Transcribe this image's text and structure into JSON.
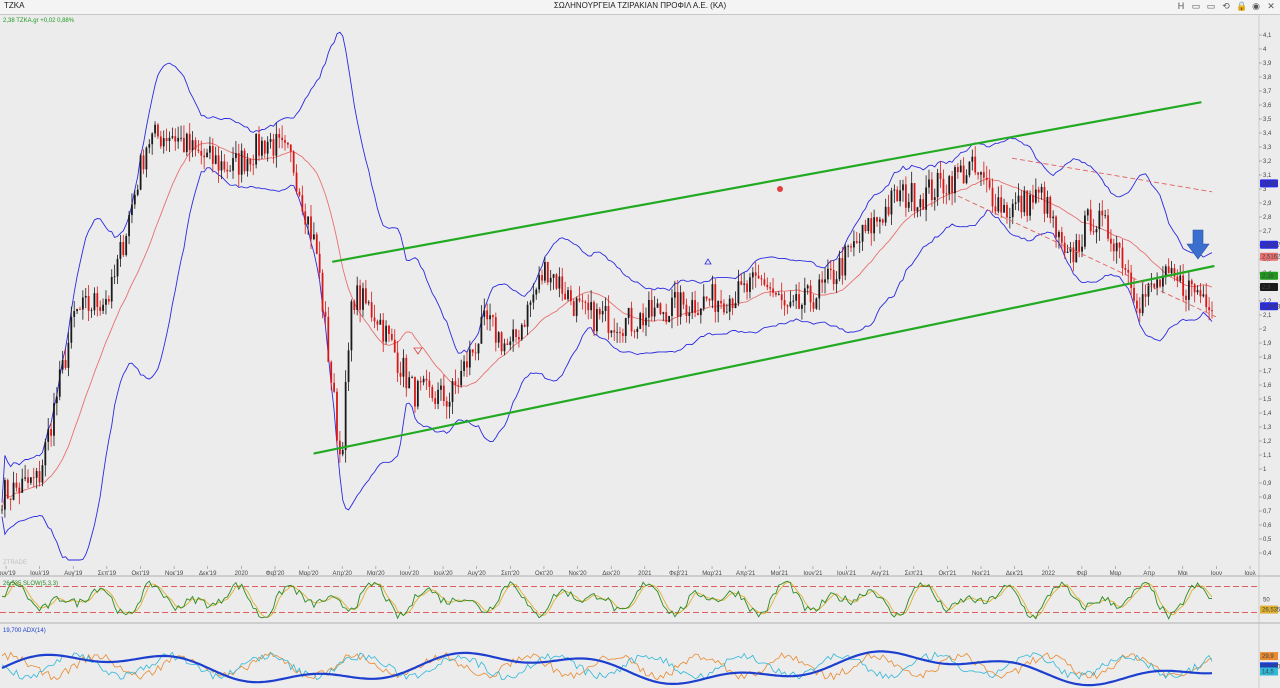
{
  "window": {
    "symbol": "TZKA",
    "title": "ΣΩΛΗΝΟΥΡΓΕΙΑ ΤΖΙΡΑΚΙΑΝ ΠΡΟΦΙΛ Α.Ε. (ΚΑ)",
    "buttons": [
      "H",
      "▭",
      "▭",
      "⟲",
      "🔒",
      "◉",
      "✕"
    ]
  },
  "colors": {
    "bg": "#ececec",
    "up": "#1a1a1a",
    "down": "#d81818",
    "bb": "#2a2ae0",
    "ma": "#e87070",
    "channel": "#22aa22",
    "stoch_k": "#2a8a2a",
    "stoch_d": "#e0b030",
    "adx": "#1c3fcf",
    "dip": "#e88a30",
    "dim": "#30b8d8",
    "arrow": "#3a6fd0"
  },
  "price_label": {
    "text": "2,38 TZKA.gr +0,02 0,88%"
  },
  "watermark": "ΖTRADE",
  "stoch_label": "26,535 SLOW(5,3,3)",
  "adx_label": "19,700 ADX(14)",
  "chart_data": [
    {
      "type": "candlestick",
      "title": "TZKA",
      "ylim": [
        0.35,
        4.15
      ],
      "y_ticks": [
        "0,4",
        "0,5",
        "0,6",
        "0,7",
        "0,8",
        "0,9",
        "1",
        "1,1",
        "1,2",
        "1,3",
        "1,4",
        "1,5",
        "1,6",
        "1,7",
        "1,8",
        "1,9",
        "2",
        "2,1",
        "2,2",
        "2,3",
        "2,4",
        "2,5",
        "2,6",
        "2,7",
        "2,8",
        "2,9",
        "3",
        "3,1",
        "3,2",
        "3,3",
        "3,4",
        "3,5",
        "3,6",
        "3,7",
        "3,8",
        "3,9",
        "4",
        "4,1"
      ],
      "x_ticks": [
        "Ιουν'19",
        "Ιουλ'19",
        "Αυγ'19",
        "Σεπ'19",
        "Οκτ'19",
        "Νοε'19",
        "Δεκ'19",
        "2020",
        "Φεβ'20",
        "Μαρ'20",
        "Απρ'20",
        "Μαι'20",
        "Ιουν'20",
        "Ιουλ'20",
        "Αυγ'20",
        "Σεπ'20",
        "Οκτ'20",
        "Νοε'20",
        "Δεκ'20",
        "2021",
        "Φεβ'21",
        "Μαρ'21",
        "Απρ'21",
        "Μαι'21",
        "Ιουν'21",
        "Ιουλ'21",
        "Αυγ'21",
        "Σεπ'21",
        "Οκτ'21",
        "Νοε'21",
        "Δεκ'21",
        "2022",
        "Φεβ",
        "Μαρ",
        "Απρ",
        "Μαι",
        "Ιουν",
        "Ιουλ"
      ],
      "close_path_t": [
        0,
        0.03,
        0.06,
        0.09,
        0.12,
        0.14,
        0.16,
        0.19,
        0.22,
        0.24,
        0.26,
        0.28,
        0.29,
        0.31,
        0.34,
        0.37,
        0.4,
        0.42,
        0.45,
        0.48,
        0.52,
        0.55,
        0.58,
        0.61,
        0.63,
        0.65,
        0.68,
        0.71,
        0.74,
        0.76,
        0.8,
        0.83,
        0.86,
        0.88,
        0.9,
        0.92,
        0.94,
        0.96,
        0.98,
        1.0
      ],
      "close_path_v": [
        0.82,
        0.92,
        2.1,
        2.25,
        3.35,
        3.4,
        3.25,
        3.15,
        3.35,
        3.2,
        2.55,
        1.05,
        2.25,
        2.1,
        1.55,
        1.5,
        2.05,
        1.85,
        2.45,
        2.1,
        2.05,
        2.15,
        2.2,
        2.25,
        2.35,
        2.1,
        2.3,
        2.65,
        2.95,
        2.95,
        3.15,
        2.85,
        2.95,
        2.45,
        2.8,
        2.65,
        2.2,
        2.35,
        2.3,
        2.22
      ],
      "last_values": [
        "3,040",
        "2,6017",
        "2,5162",
        "2,38",
        "2,3",
        "2,1623"
      ],
      "channel_upper": [
        [
          "Απρ'20",
          2.48
        ],
        [
          "Ιουν",
          3.62
        ]
      ],
      "channel_lower": [
        [
          "Μαρ'20",
          1.11
        ],
        [
          "Ιουν",
          2.45
        ]
      ],
      "annotations": [
        "down-arrow-at-Ιουν"
      ]
    },
    {
      "type": "line",
      "title": "26,535 SLOW(5,3,3)",
      "ylim": [
        0,
        100
      ],
      "y_ticks": [
        "50"
      ],
      "ref_lines": [
        80,
        20
      ],
      "last_values": [
        "26,535"
      ]
    },
    {
      "type": "line",
      "title": "19,700 ADX(14)",
      "ylim": [
        0,
        60
      ],
      "last_values": [
        "29,9",
        "19,700",
        "14,5"
      ]
    }
  ]
}
